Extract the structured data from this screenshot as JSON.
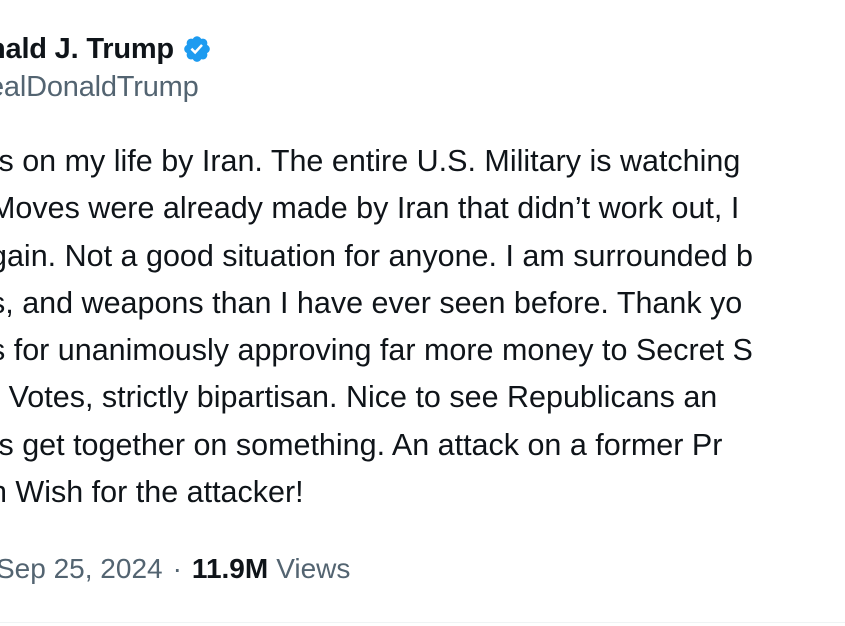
{
  "author": {
    "display_name": "nald J. Trump",
    "handle": "ealDonaldTrump"
  },
  "verified_icon": "verified-badge-icon",
  "tweet": {
    "lines": [
      "ts on my life by Iran. The entire U.S. Military is watching",
      "Moves were already made by Iran that didn’t work out, I",
      "gain. Not a good situation for anyone. I am surrounded b",
      "s, and weapons than I have ever seen before. Thank yo",
      "s for unanimously approving far more money to Secret S",
      "” Votes, strictly bipartisan. Nice to see Republicans an",
      "ts get together on something. An attack on a former Pr",
      "h Wish for the attacker!"
    ]
  },
  "meta": {
    "date": "Sep 25, 2024",
    "separator": "·",
    "views_count": "11.9M",
    "views_label": "Views"
  },
  "colors": {
    "text_primary": "#0f1419",
    "text_secondary": "#536471",
    "verified_blue": "#1d9bf0"
  }
}
